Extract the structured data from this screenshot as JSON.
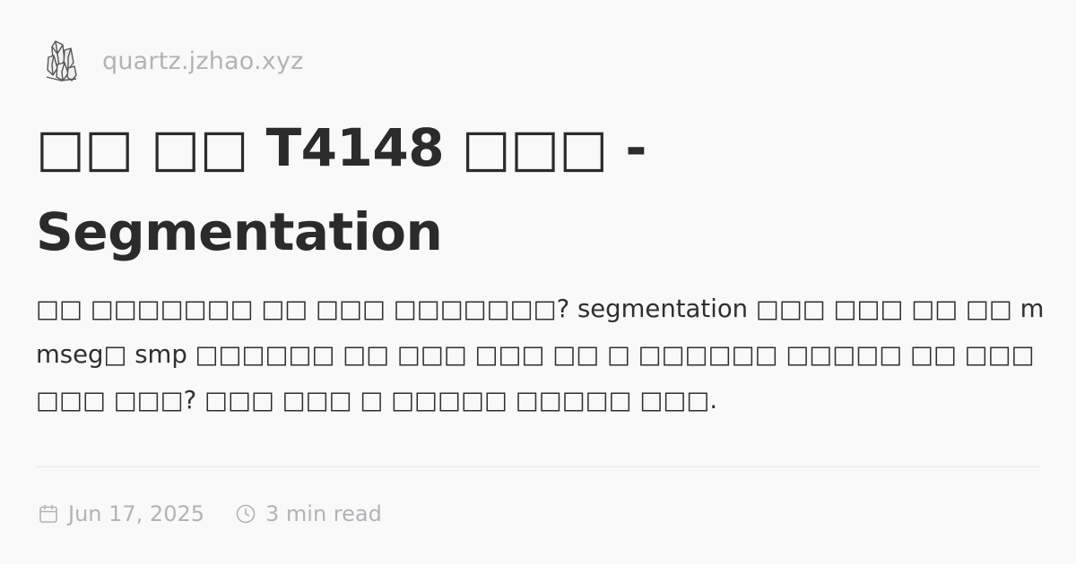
{
  "site": {
    "logo_icon": "crystal-icon",
    "url": "quartz.jzhao.xyz"
  },
  "post": {
    "title": "□□ □□ T4148 □□□ - Segmentation",
    "description": "□□ □□□□□□□ □□ □□□ □□□□□□□? segmentation □□□ □□□ □□ □□ mmseg□ smp □□□□□□ □□ □□□ □□□ □□ □ □□□□□□ □□□□□ □□ □□□ □□□ □□□? □□□ □□□ □ □□□□□ □□□□□ □□□.",
    "date": "Jun 17, 2025",
    "date_icon": "calendar-icon",
    "reading_time": "3 min read",
    "reading_time_icon": "clock-icon"
  },
  "colors": {
    "background": "#faf9fa",
    "title_text": "#2b2b2b",
    "body_text": "#2f2f2f",
    "muted_text": "#b4b2b6",
    "divider": "#e6e5e7"
  }
}
